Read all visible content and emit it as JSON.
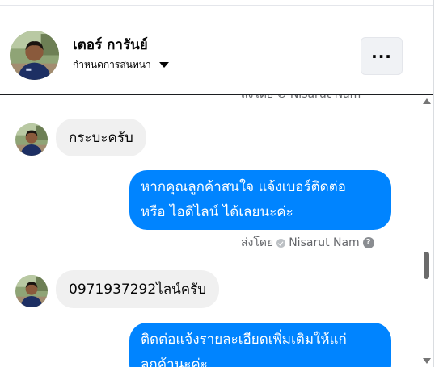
{
  "header": {
    "contact_name": "เตอร์ การันย์",
    "contact_subtitle": "กำหนดการสนทนา",
    "more_label": "···"
  },
  "chat": {
    "clipped_meta": "ส่งโดย ⊘ Nisarut Nam",
    "messages": [
      {
        "direction": "incoming",
        "text": "กระบะครับ"
      },
      {
        "direction": "outgoing",
        "lines": [
          "หากคุณลูกค้าสนใจ แจ้งเบอร์ติดต่อ",
          "หรือ ไอดีไลน์ ได้เลยนะค่ะ"
        ]
      },
      {
        "direction": "incoming",
        "text": "0971937292ไลน์ครับ"
      },
      {
        "direction": "outgoing",
        "lines": [
          "ติดต่อแจ้งรายละเอียดเพิ่มเติมให้แก่",
          "ลูกค้านะค่ะ"
        ]
      }
    ],
    "sent_by_label": "ส่งโดย",
    "sent_by_name": "Nisarut Nam",
    "help_glyph": "?"
  },
  "colors": {
    "outgoing_bubble": "#0084ff",
    "incoming_bubble": "#f0f0f0",
    "meta_text": "#65676b"
  },
  "icons": [
    "avatar",
    "chevron-down-icon",
    "more-icon",
    "verified-check-icon",
    "help-icon",
    "scroll-up-icon",
    "scroll-down-icon"
  ]
}
